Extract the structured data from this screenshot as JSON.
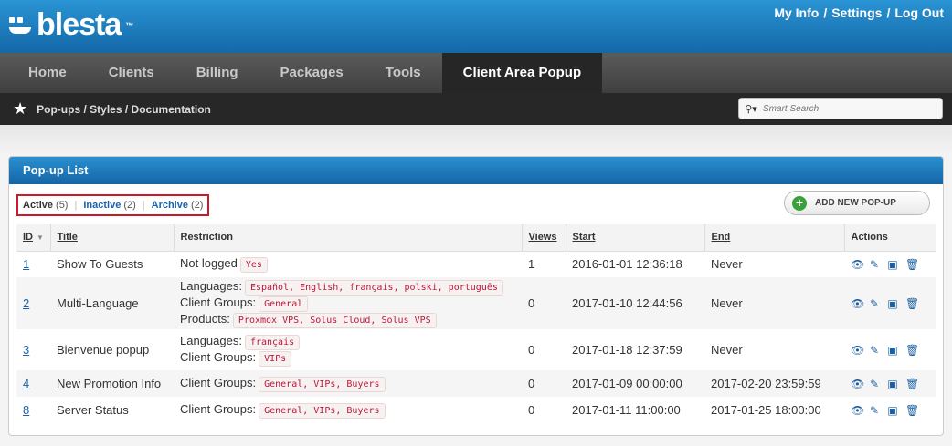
{
  "header": {
    "logo_text": "blesta",
    "logo_tm": "™",
    "user_links": [
      "My Info",
      "Settings",
      "Log Out"
    ],
    "separator": "/"
  },
  "nav": {
    "tabs": [
      "Home",
      "Clients",
      "Billing",
      "Packages",
      "Tools",
      "Client Area Popup"
    ],
    "active_tab": "Client Area Popup"
  },
  "subnav": {
    "crumbs": [
      "Pop-ups",
      "Styles",
      "Documentation"
    ],
    "search_placeholder": "Smart Search"
  },
  "panel": {
    "title": "Pop-up List",
    "filters": [
      {
        "label": "Active",
        "count": "(5)"
      },
      {
        "label": "Inactive",
        "count": "(2)"
      },
      {
        "label": "Archive",
        "count": "(2)"
      }
    ],
    "add_button": "ADD NEW POP-UP"
  },
  "table": {
    "columns": [
      "ID",
      "Title",
      "Restriction",
      "Views",
      "Start",
      "End",
      "Actions"
    ],
    "rows": [
      {
        "id": "1",
        "title": "Show To Guests",
        "restriction": [
          {
            "label": "Not logged",
            "tag": "Yes"
          }
        ],
        "views": "1",
        "start": "2016-01-01 12:36:18",
        "end": "Never"
      },
      {
        "id": "2",
        "title": "Multi-Language",
        "restriction": [
          {
            "label": "Languages:",
            "tag": "Español, English, français, polski, português"
          },
          {
            "label": "Client Groups:",
            "tag": "General"
          },
          {
            "label": "Products:",
            "tag": "Proxmox VPS, Solus Cloud, Solus VPS"
          }
        ],
        "views": "0",
        "start": "2017-01-10 12:44:56",
        "end": "Never"
      },
      {
        "id": "3",
        "title": "Bienvenue popup",
        "restriction": [
          {
            "label": "Languages:",
            "tag": "français"
          },
          {
            "label": "Client Groups:",
            "tag": "VIPs"
          }
        ],
        "views": "0",
        "start": "2017-01-18 12:37:59",
        "end": "Never"
      },
      {
        "id": "4",
        "title": "New Promotion Info",
        "restriction": [
          {
            "label": "Client Groups:",
            "tag": "General, VIPs, Buyers"
          }
        ],
        "views": "0",
        "start": "2017-01-09 00:00:00",
        "end": "2017-02-20 23:59:59"
      },
      {
        "id": "8",
        "title": "Server Status",
        "restriction": [
          {
            "label": "Client Groups:",
            "tag": "General, VIPs, Buyers"
          }
        ],
        "views": "0",
        "start": "2017-01-11 11:00:00",
        "end": "2017-01-25 18:00:00"
      }
    ],
    "action_icons": [
      "eye-icon",
      "edit-icon",
      "archive-icon",
      "trash-icon"
    ]
  }
}
